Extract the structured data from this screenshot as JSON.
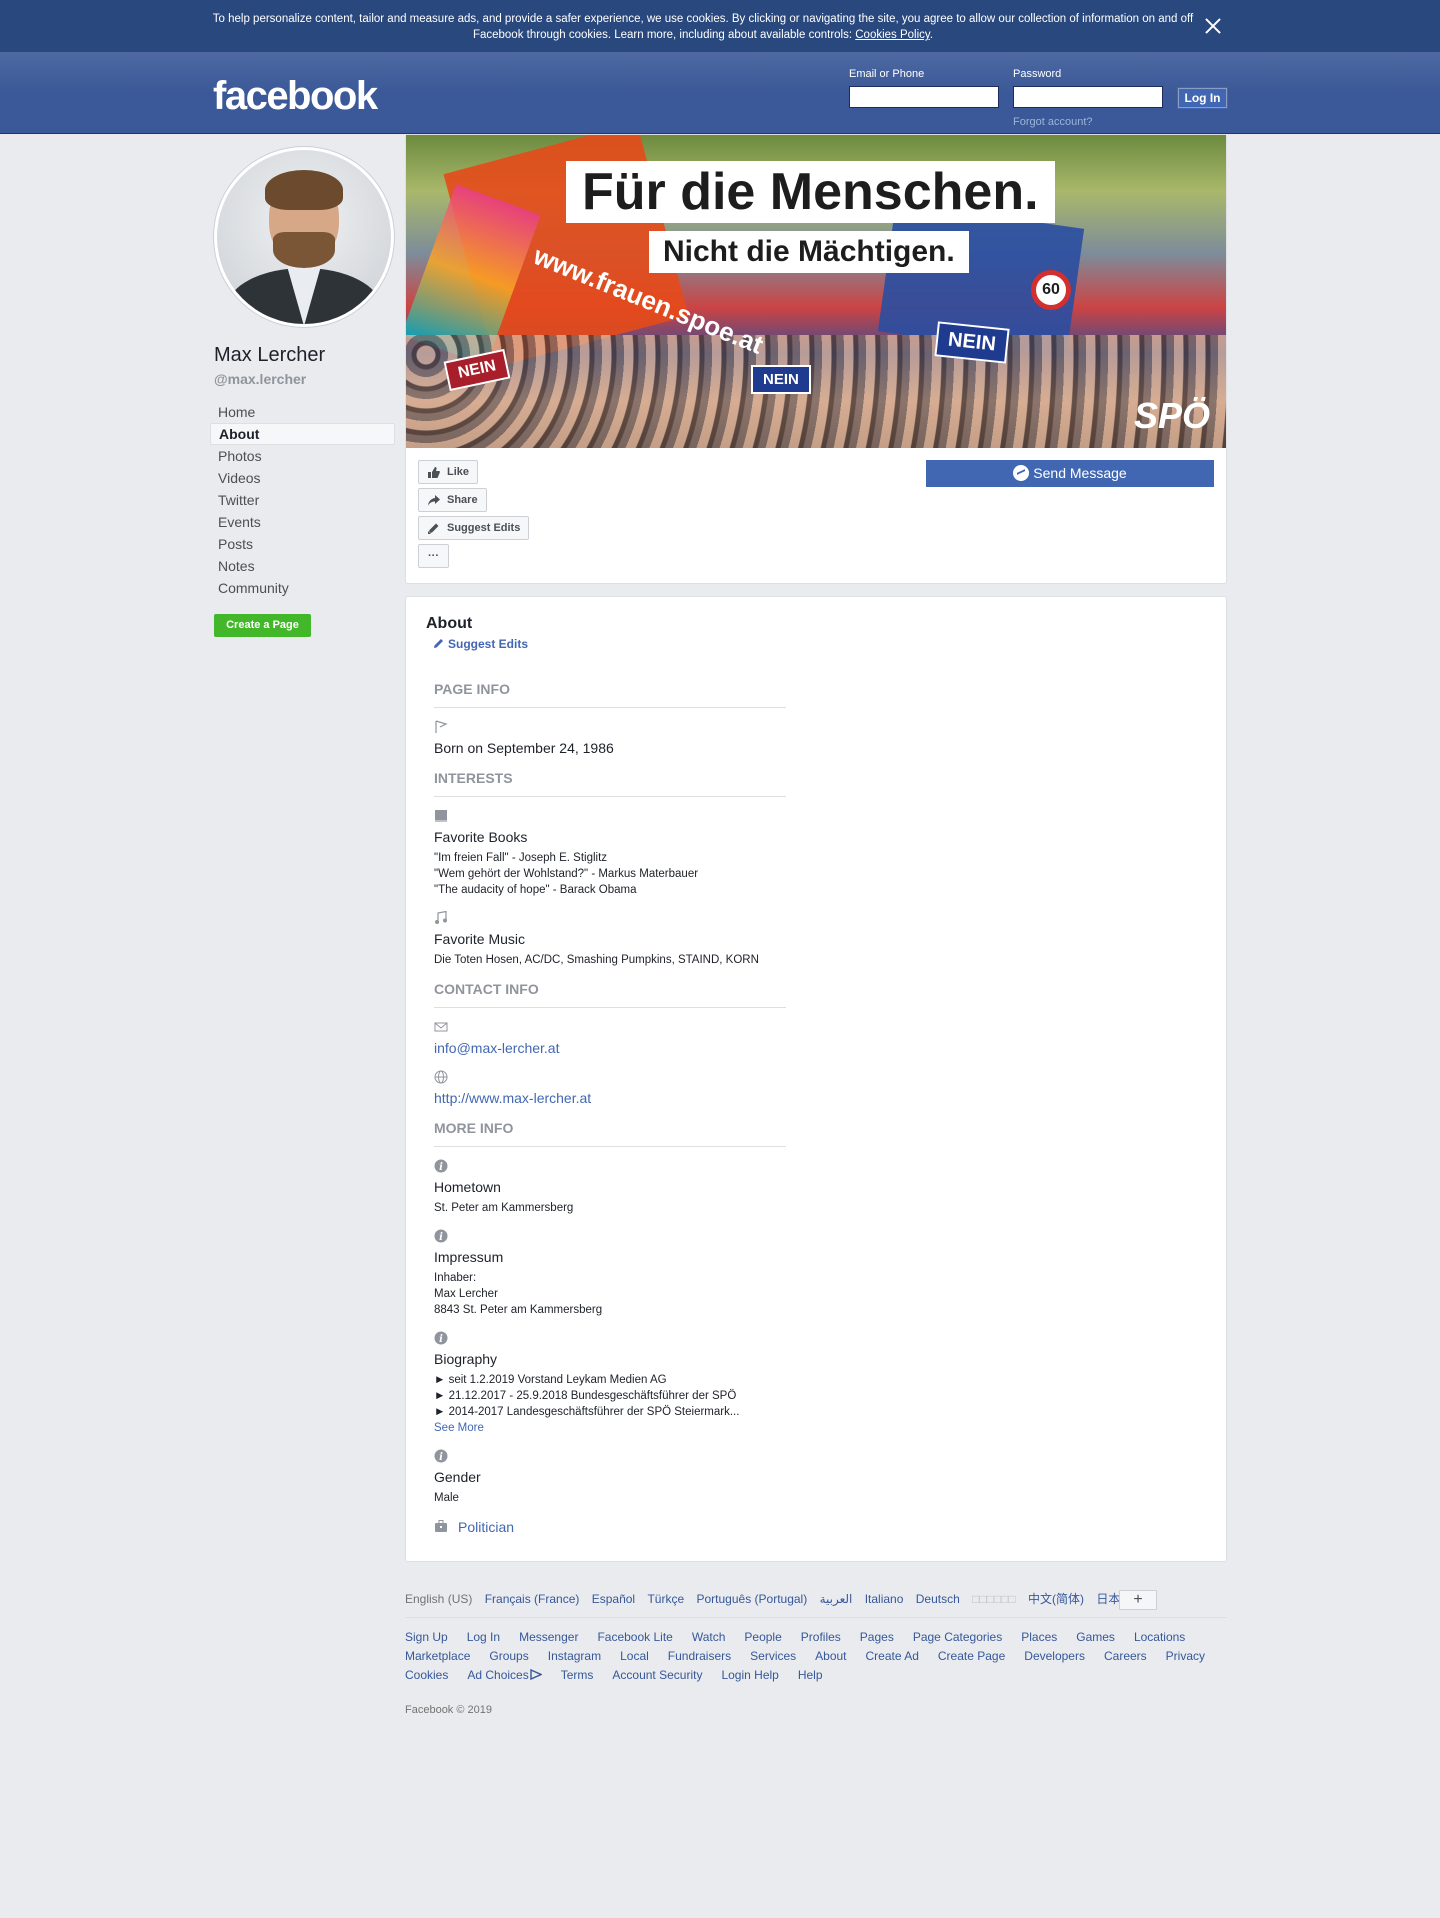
{
  "cookie_bar": {
    "text": "To help personalize content, tailor and measure ads, and provide a safer experience, we use cookies. By clicking or navigating the site, you agree to allow our collection of information on and off Facebook through cookies. Learn more, including about available controls: ",
    "policy_link": "Cookies Policy",
    "end": "."
  },
  "header": {
    "logo": "facebook",
    "email_label": "Email or Phone",
    "password_label": "Password",
    "login_button": "Log In",
    "forgot_link": "Forgot account?"
  },
  "profile": {
    "name": "Max Lercher",
    "handle": "@max.lercher"
  },
  "nav": {
    "items": [
      "Home",
      "About",
      "Photos",
      "Videos",
      "Twitter",
      "Events",
      "Posts",
      "Notes",
      "Community"
    ],
    "active": "About",
    "create_page": "Create a Page"
  },
  "cover": {
    "headline": "Für die Menschen.",
    "subline": "Nicht die Mächtigen.",
    "sign1": "NEIN",
    "sign2": "NEIN",
    "sign3": "NEIN",
    "sign60": "60",
    "url_text": "www.frauen.spoe.at",
    "brand": "SPÖ"
  },
  "actions": {
    "like": "Like",
    "share": "Share",
    "suggest_edits": "Suggest Edits",
    "more": "···",
    "send_message": "Send Message"
  },
  "about": {
    "title": "About",
    "suggest_edits": "Suggest Edits",
    "page_info_head": "PAGE INFO",
    "born": "Born on September 24, 1986",
    "interests_head": "INTERESTS",
    "fav_books_label": "Favorite Books",
    "fav_books": [
      "\"Im freien Fall\" - Joseph E. Stiglitz",
      "\"Wem gehört der Wohlstand?\" - Markus Materbauer",
      "\"The audacity of hope\" - Barack Obama"
    ],
    "fav_music_label": "Favorite Music",
    "fav_music": "Die Toten Hosen, AC/DC, Smashing Pumpkins, STAIND, KORN",
    "contact_head": "CONTACT INFO",
    "email": "info@max-lercher.at",
    "website": "http://www.max-lercher.at",
    "more_info_head": "MORE INFO",
    "hometown_label": "Hometown",
    "hometown": "St. Peter am Kammersberg",
    "impressum_label": "Impressum",
    "impressum": [
      "Inhaber:",
      "Max Lercher",
      "8843 St. Peter am Kammersberg"
    ],
    "biography_label": "Biography",
    "biography": [
      "► seit 1.2.2019 Vorstand Leykam Medien AG",
      "► 21.12.2017 - 25.9.2018 Bundesgeschäftsführer der SPÖ",
      "► 2014-2017 Landesgeschäftsführer der SPÖ Steiermark..."
    ],
    "see_more": "See More",
    "gender_label": "Gender",
    "gender": "Male",
    "category": "Politician"
  },
  "footer": {
    "languages": [
      "English (US)",
      "Français (France)",
      "Español",
      "Türkçe",
      "Português (Portugal)",
      "العربية",
      "Italiano",
      "Deutsch",
      "□□□□□□",
      "中文(简体)",
      "日本語"
    ],
    "lang_plus": "+",
    "links": [
      "Sign Up",
      "Log In",
      "Messenger",
      "Facebook Lite",
      "Watch",
      "People",
      "Profiles",
      "Pages",
      "Page Categories",
      "Places",
      "Games",
      "Locations",
      "Marketplace",
      "Groups",
      "Instagram",
      "Local",
      "Fundraisers",
      "Services",
      "About",
      "Create Ad",
      "Create Page",
      "Developers",
      "Careers",
      "Privacy",
      "Cookies",
      "Ad Choices",
      "Terms",
      "Account Security",
      "Login Help",
      "Help"
    ],
    "copyright": "Facebook © 2019"
  }
}
